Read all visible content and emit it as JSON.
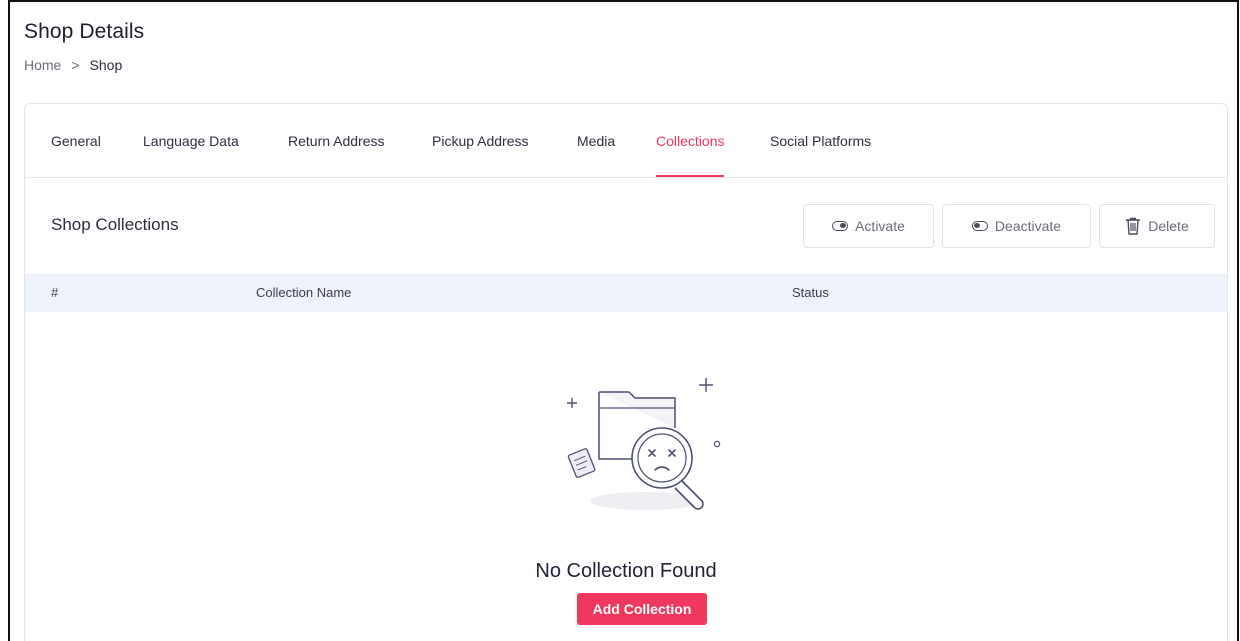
{
  "header": {
    "title": "Shop Details",
    "breadcrumb": {
      "home": "Home",
      "separator": ">",
      "current": "Shop"
    }
  },
  "tabs": [
    {
      "label": "General",
      "active": false
    },
    {
      "label": "Language Data",
      "active": false
    },
    {
      "label": "Return Address",
      "active": false
    },
    {
      "label": "Pickup Address",
      "active": false
    },
    {
      "label": "Media",
      "active": false
    },
    {
      "label": "Collections",
      "active": true
    },
    {
      "label": "Social Platforms",
      "active": false
    }
  ],
  "section": {
    "title": "Shop Collections",
    "actions": {
      "activate_label": "Activate",
      "deactivate_label": "Deactivate",
      "delete_label": "Delete"
    }
  },
  "table": {
    "columns": [
      "#",
      "Collection Name",
      "Status"
    ]
  },
  "empty_state": {
    "message": "No Collection Found",
    "button_label": "Add Collection"
  },
  "colors": {
    "accent": "#f0375d",
    "table_header_bg": "#eef2fb"
  }
}
